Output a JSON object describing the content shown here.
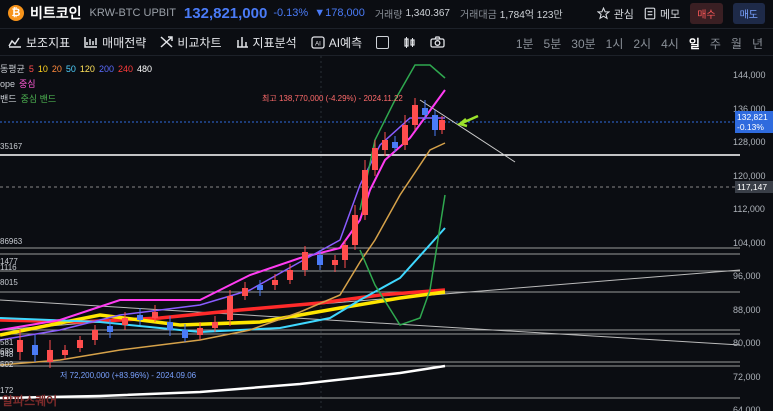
{
  "header": {
    "coin_icon": "bitcoin-icon",
    "coin_name": "비트코인",
    "pair": "KRW-BTC  UPBIT",
    "price": "132,821,000",
    "change_pct": "-0.13%",
    "change_abs": "▼178,000",
    "volume_label": "거래량",
    "volume_value": "1,340.367",
    "amount_label": "거래대금",
    "amount_value": "1,784억 123만",
    "favorite_label": "관심",
    "memo_label": "메모",
    "buy_label": "매수",
    "sell_label": "매도"
  },
  "toolbar": {
    "indicator_label": "보조지표",
    "strategy_label": "매매전략",
    "compare_label": "비교차트",
    "analysis_label": "지표분석",
    "ai_label": "AI예측",
    "intervals": [
      "1분",
      "5분",
      "30분",
      "1시",
      "2시",
      "4시",
      "일",
      "주",
      "월",
      "년"
    ],
    "active_interval": "일"
  },
  "legend": {
    "ma_prefix": "동평균",
    "ma_periods": [
      "5",
      "10",
      "20",
      "50",
      "120",
      "200",
      "240",
      "480"
    ],
    "ma_colors": [
      "#ff4d4d",
      "#ffd21f",
      "#ff8a3d",
      "#4fd1ff",
      "#ffe15a",
      "#5b6cff",
      "#ff3b3b",
      "#ffffff"
    ],
    "envelope_prefix": "ope",
    "envelope_label": "중심",
    "band_prefix": "밴드",
    "band_label": "중심 밴드"
  },
  "chart": {
    "y_ticks": [
      "144,000",
      "136,000",
      "128,000",
      "120,000",
      "112,000",
      "104,000",
      "96,000",
      "88,000",
      "80,000",
      "72,000",
      "64,000"
    ],
    "current_price_tag": [
      "132,821",
      "-0.13%"
    ],
    "level_tag": "117,147",
    "hline_labels": [
      "35167",
      "86963",
      "1477",
      "1116",
      "8015",
      "581",
      "689",
      "948",
      "602",
      "172"
    ],
    "peak_label": "최고 138,770,000 (-4.29%) - 2024.11.22",
    "low_label": "저 72,200,000 (+83.96%) - 2024.09.06",
    "watermark": "알파스퀘어"
  }
}
